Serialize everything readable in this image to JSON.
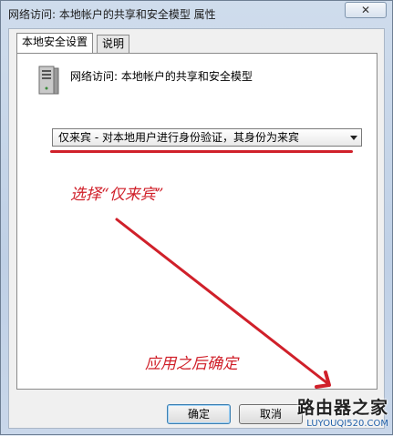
{
  "window": {
    "title": "网络访问: 本地帐户的共享和安全模型 属性",
    "close_symbol": "✕"
  },
  "tabs": [
    {
      "label": "本地安全设置",
      "active": true
    },
    {
      "label": "说明",
      "active": false
    }
  ],
  "policy": {
    "icon": "server-icon",
    "name": "网络访问: 本地帐户的共享和安全模型",
    "selected_option": "仅来宾 - 对本地用户进行身份验证，其身份为来宾"
  },
  "annotations": {
    "select_note": "选择“仅来宾”",
    "apply_note": "应用之后确定",
    "color": "#d0202a"
  },
  "buttons": {
    "ok_label": "确定",
    "cancel_label": "取消"
  },
  "watermark": {
    "logo_text": "路由器之家",
    "url": "LUYOUQI520.COM"
  }
}
